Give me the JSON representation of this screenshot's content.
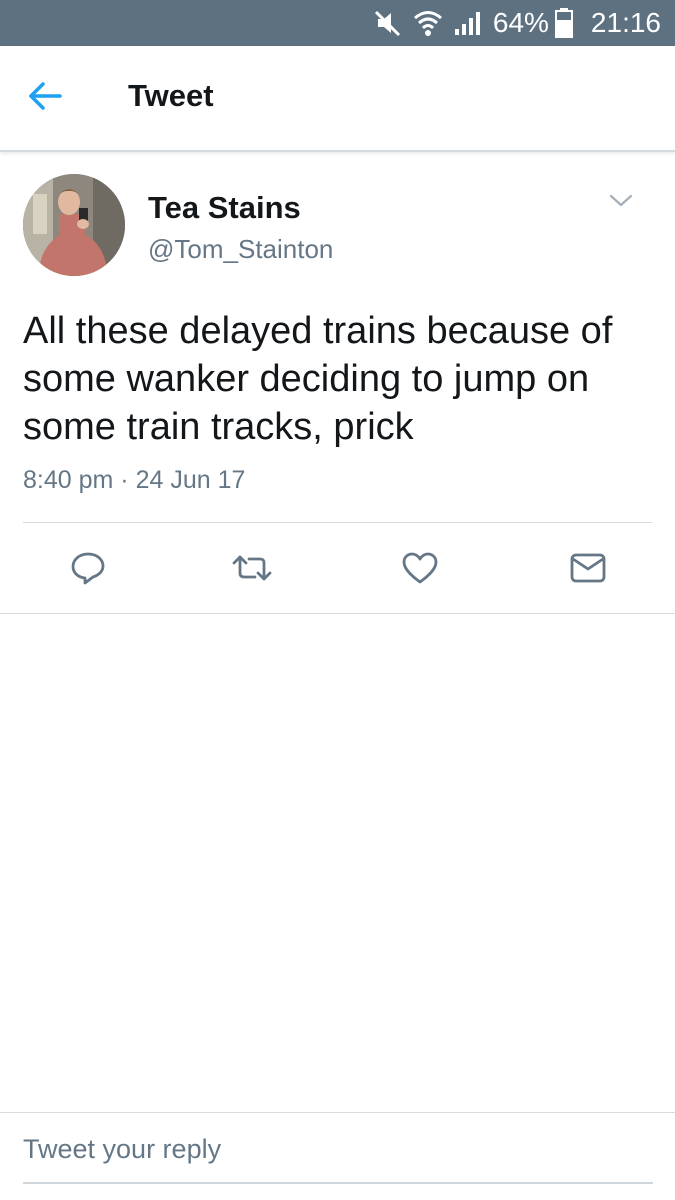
{
  "status_bar": {
    "battery": "64%",
    "time": "21:16",
    "icons": [
      "mute-icon",
      "wifi-icon",
      "signal-icon",
      "battery-icon"
    ]
  },
  "header": {
    "title": "Tweet",
    "back_icon": "back-arrow-icon"
  },
  "tweet": {
    "display_name": "Tea Stains",
    "handle": "@Tom_Stainton",
    "text": "All these delayed trains because of some wanker deciding to jump on some train tracks, prick",
    "time": "8:40 pm",
    "separator": "·",
    "date": "24 Jun 17",
    "actions": [
      "reply-icon",
      "retweet-icon",
      "like-icon",
      "direct-message-icon"
    ]
  },
  "reply": {
    "placeholder": "Tweet your reply"
  },
  "colors": {
    "status_bar": "#5e7181",
    "accent": "#1da1f2",
    "primary_text": "#14171a",
    "secondary_text": "#657786",
    "divider": "#d6dbe0"
  }
}
